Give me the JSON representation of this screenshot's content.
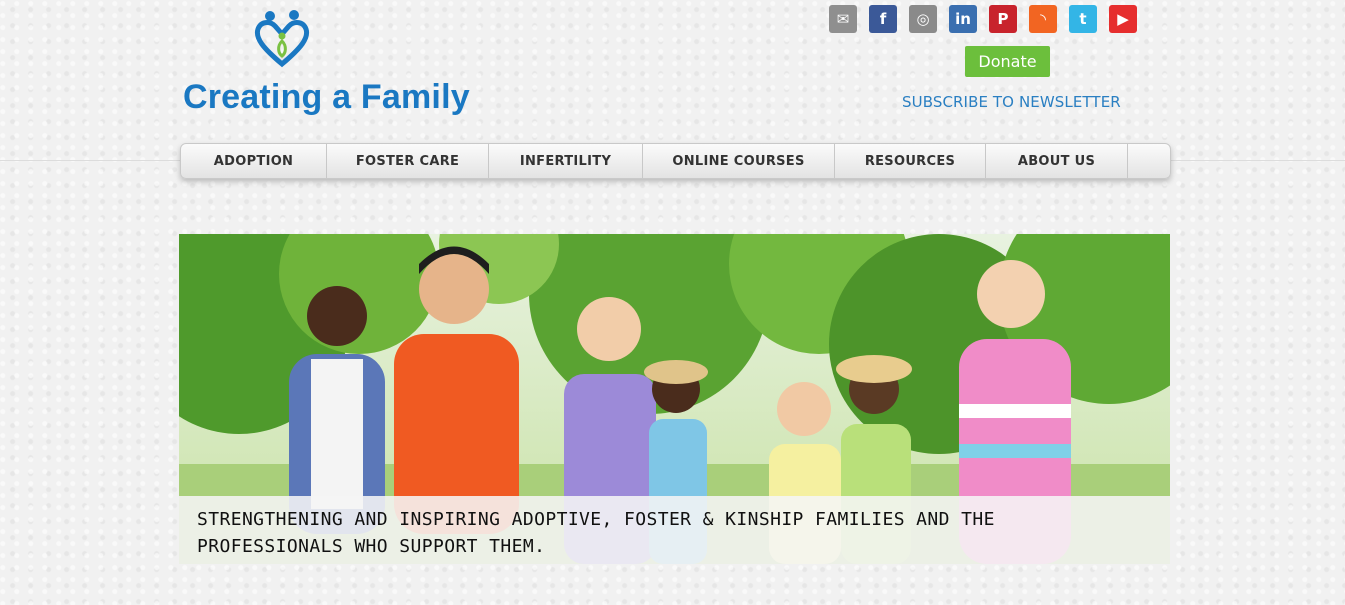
{
  "logo": {
    "name": "Creating a Family",
    "colors": {
      "blue": "#1a78c2",
      "green": "#7ac143"
    }
  },
  "social": [
    {
      "icon": "email-icon",
      "glyph": "✉",
      "color": "#8f8f8f"
    },
    {
      "icon": "facebook-icon",
      "glyph": "f",
      "color": "#3b5998"
    },
    {
      "icon": "instagram-icon",
      "glyph": "◎",
      "color": "#8a8a8a"
    },
    {
      "icon": "linkedin-icon",
      "glyph": "in",
      "color": "#3a6fb0"
    },
    {
      "icon": "pinterest-icon",
      "glyph": "P",
      "color": "#c8232c"
    },
    {
      "icon": "rss-icon",
      "glyph": "◝",
      "color": "#f26522"
    },
    {
      "icon": "twitter-icon",
      "glyph": "t",
      "color": "#33b5e6"
    },
    {
      "icon": "youtube-icon",
      "glyph": "▶",
      "color": "#e62e2e"
    }
  ],
  "donate": {
    "label": "Donate",
    "color": "#6cbf3c"
  },
  "newsletter": {
    "label": "SUBSCRIBE TO NEWSLETTER"
  },
  "nav": {
    "items": [
      {
        "label": "ADOPTION"
      },
      {
        "label": "FOSTER CARE"
      },
      {
        "label": "INFERTILITY"
      },
      {
        "label": "ONLINE COURSES"
      },
      {
        "label": "RESOURCES"
      },
      {
        "label": "ABOUT US"
      }
    ]
  },
  "hero": {
    "caption": "Strengthening and inspiring adoptive, foster & kinship families and the professionals who support them."
  }
}
